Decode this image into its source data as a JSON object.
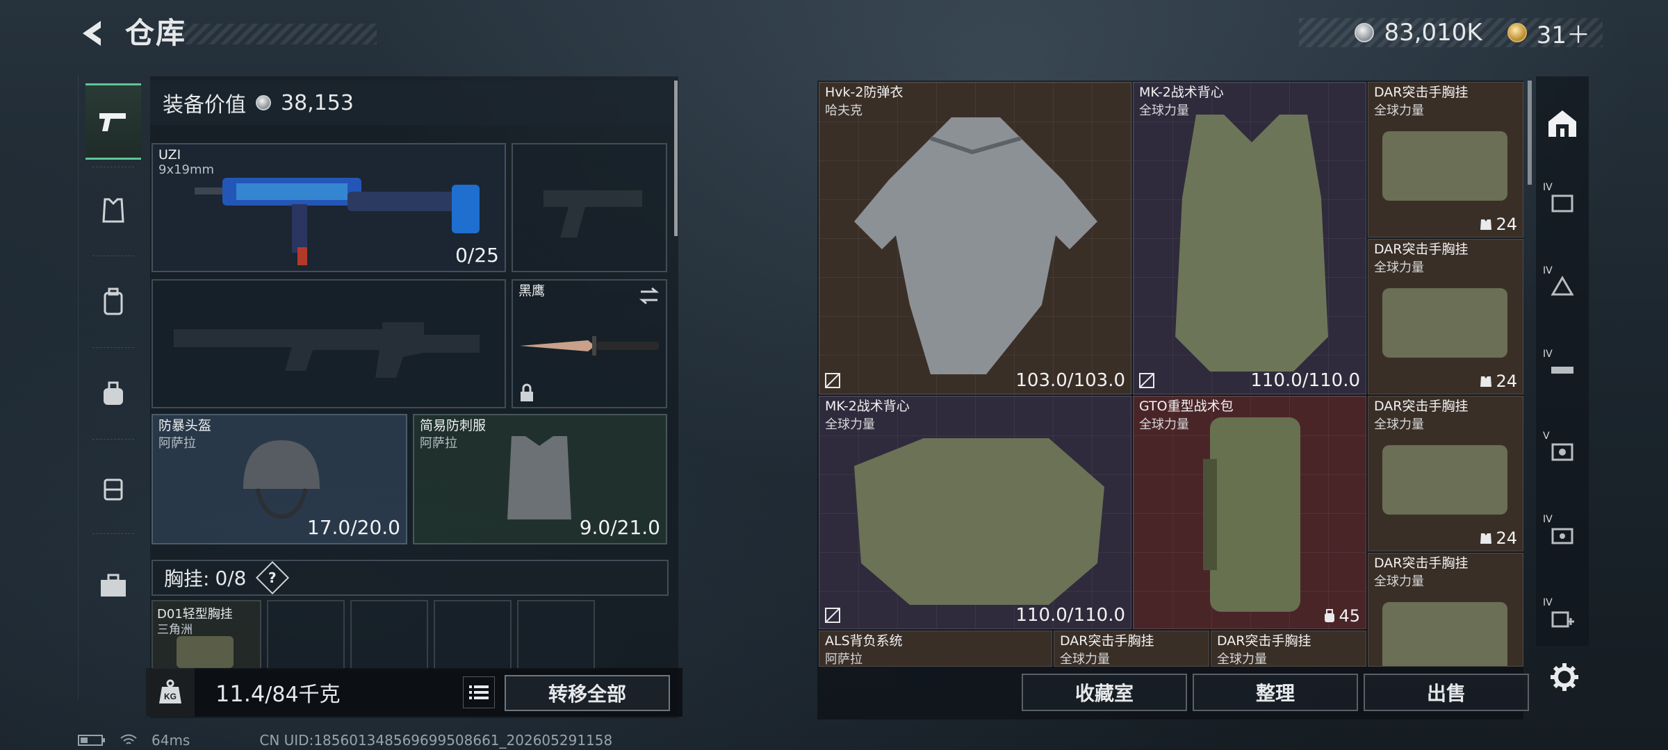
{
  "header": {
    "title": "仓库",
    "currency": [
      {
        "type": "silver",
        "value": "83,010K"
      },
      {
        "type": "gold",
        "value": "31＋"
      }
    ]
  },
  "loadout": {
    "equip_value_label": "装备价值",
    "equip_value": "38,153",
    "primary_weapon": {
      "name": "UZI",
      "sub": "9x19mm",
      "ammo": "0/25"
    },
    "melee": {
      "name": "黑鹰"
    },
    "helmet": {
      "name": "防暴头盔",
      "sub": "阿萨拉",
      "durability": "17.0/20.0"
    },
    "armor": {
      "name": "简易防刺服",
      "sub": "阿萨拉",
      "durability": "9.0/21.0"
    },
    "chest_rig_label": "胸挂:",
    "chest_rig_count": "0/8",
    "chest_rig_slot": {
      "name": "D01轻型胸挂",
      "sub": "三角洲"
    },
    "weight": "11.4",
    "weight_max": "/84千克",
    "transfer_all": "转移全部"
  },
  "storage": {
    "items": [
      {
        "name": "Hvk-2防弹衣",
        "sub": "哈夫克",
        "value": "103.0/103.0"
      },
      {
        "name": "MK-2战术背心",
        "sub": "全球力量",
        "value": "110.0/110.0"
      },
      {
        "name": "DAR突击手胸挂",
        "sub": "全球力量",
        "value": "24"
      },
      {
        "name": "DAR突击手胸挂",
        "sub": "全球力量",
        "value": "24"
      },
      {
        "name": "MK-2战术背心",
        "sub": "全球力量",
        "value": "110.0/110.0"
      },
      {
        "name": "GTO重型战术包",
        "sub": "全球力量",
        "value": "45"
      },
      {
        "name": "DAR突击手胸挂",
        "sub": "全球力量",
        "value": "24"
      },
      {
        "name": "DAR突击手胸挂",
        "sub": "全球力量",
        "value": ""
      },
      {
        "name": "ALS背负系统",
        "sub": "阿萨拉",
        "value": ""
      },
      {
        "name": "DAR突击手胸挂",
        "sub": "全球力量",
        "value": ""
      },
      {
        "name": "DAR突击手胸挂",
        "sub": "全球力量",
        "value": ""
      }
    ],
    "actions": {
      "collection": "收藏室",
      "sort": "整理",
      "sell": "出售"
    }
  },
  "right_filters": [
    {
      "icon": "home-storage-icon",
      "label": ""
    },
    {
      "icon": "filter-icon",
      "label": "IV"
    },
    {
      "icon": "filter-icon",
      "label": "IV"
    },
    {
      "icon": "filter-icon",
      "label": "IV"
    },
    {
      "icon": "filter-icon",
      "label": "V"
    },
    {
      "icon": "filter-icon",
      "label": "IV"
    },
    {
      "icon": "filter-icon",
      "label": "IV"
    }
  ],
  "footer": {
    "ping": "64ms",
    "uid": "CN UID:18560134856969950866​1_202605291158"
  }
}
